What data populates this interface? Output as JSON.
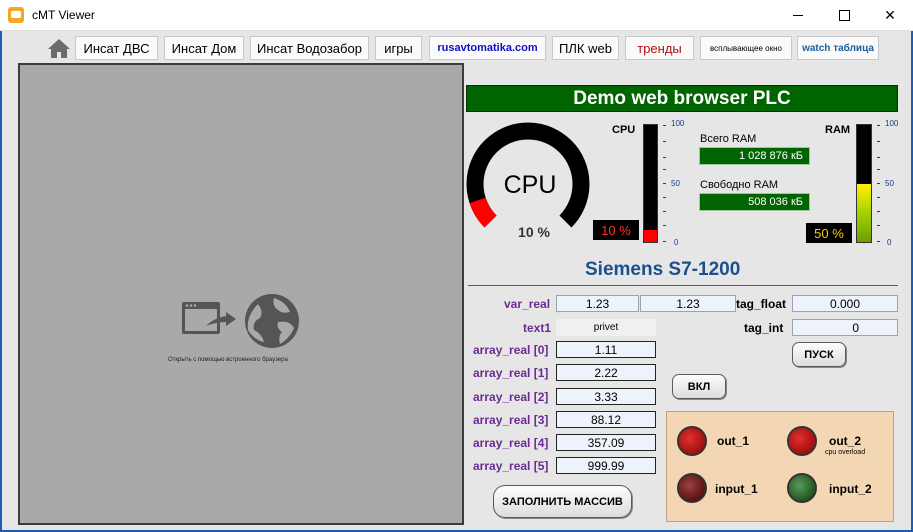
{
  "window": {
    "title": "cMT Viewer"
  },
  "toolbar": {
    "buttons": [
      {
        "label": "Инсат ДВС"
      },
      {
        "label": "Инсат Дом"
      },
      {
        "label": "Инсат Водозабор"
      },
      {
        "label": "игры"
      },
      {
        "label": "rusavtomatika.com"
      },
      {
        "label": "ПЛК web"
      },
      {
        "label": "тренды"
      },
      {
        "label": "всплывающее окно"
      },
      {
        "label": "watch таблица"
      }
    ]
  },
  "browser": {
    "caption": "Открыть с помощью встроенного браузера"
  },
  "plc": {
    "header": "Demo web browser PLC",
    "cpu": {
      "gauge_label": "CPU",
      "gauge_value": "10 %",
      "bar_label": "CPU",
      "percent_text": "10 %",
      "load_fraction": 0.1,
      "scale_top": "100",
      "scale_mid": "50",
      "scale_bottom": "0"
    },
    "ram": {
      "bar_label": "RAM",
      "total_label": "Всего RAM",
      "total_value": "1 028 876 кБ",
      "free_label": "Свободно RAM",
      "free_value": "508 036 кБ",
      "percent_text": "50 %",
      "load_fraction": 0.5,
      "scale_top": "100",
      "scale_mid": "50",
      "scale_bottom": "0"
    },
    "model": "Siemens S7-1200",
    "vars": {
      "var_real_label": "var_real",
      "var_real_value_1": "1.23",
      "var_real_value_2": "1.23",
      "tag_float_label": "tag_float",
      "tag_float_value": "0.000",
      "text1_label": "text1",
      "text1_value": "privet",
      "tag_int_label": "tag_int",
      "tag_int_value": "0",
      "array_real": [
        {
          "label": "array_real [0]",
          "value": "1.11"
        },
        {
          "label": "array_real [1]",
          "value": "2.22"
        },
        {
          "label": "array_real [2]",
          "value": "3.33"
        },
        {
          "label": "array_real [3]",
          "value": "88.12"
        },
        {
          "label": "array_real [4]",
          "value": "357.09"
        },
        {
          "label": "array_real [5]",
          "value": "999.99"
        }
      ]
    },
    "buttons": {
      "start": "ПУСК",
      "on": "ВКЛ",
      "fill_array": "ЗАПОЛНИТЬ МАССИВ"
    },
    "lamps": {
      "out_1": "out_1",
      "out_2": "out_2",
      "out_2_sub": "cpu overload",
      "input_1": "input_1",
      "input_2": "input_2"
    },
    "colors": {
      "header_bg": "#006400",
      "cpu_bar": "#ff0000",
      "ram_bar": "#c8e000",
      "label_purple": "#6a2c91",
      "model_blue": "#1d4f8c"
    }
  }
}
